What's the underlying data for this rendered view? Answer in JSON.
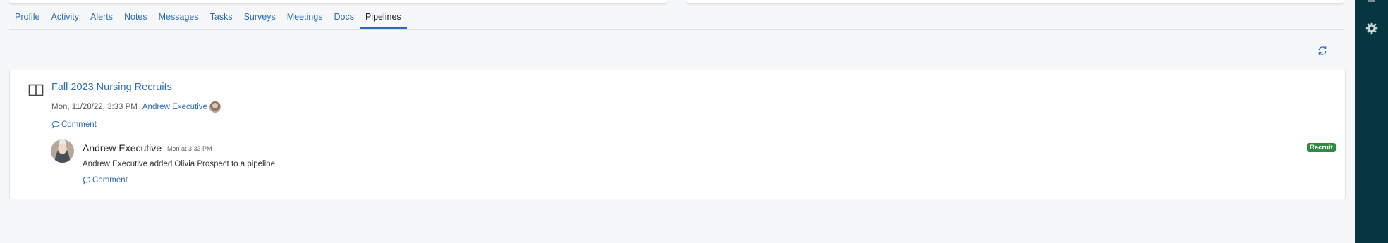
{
  "tabs": [
    {
      "label": "Profile",
      "active": false
    },
    {
      "label": "Activity",
      "active": false
    },
    {
      "label": "Alerts",
      "active": false
    },
    {
      "label": "Notes",
      "active": false
    },
    {
      "label": "Messages",
      "active": false
    },
    {
      "label": "Tasks",
      "active": false
    },
    {
      "label": "Surveys",
      "active": false
    },
    {
      "label": "Meetings",
      "active": false
    },
    {
      "label": "Docs",
      "active": false
    },
    {
      "label": "Pipelines",
      "active": true
    }
  ],
  "pipeline": {
    "icon": "board-columns-icon",
    "title": "Fall 2023 Nursing Recruits",
    "timestamp": "Mon, 11/28/22, 3:33 PM",
    "user": "Andrew Executive",
    "comment_label": "Comment"
  },
  "activity": {
    "author": "Andrew Executive",
    "time": "Mon at 3:33 PM",
    "text": "Andrew Executive added Olivia Prospect to a pipeline",
    "comment_label": "Comment",
    "badge": "Recruit",
    "badge_color": "#2f8a44"
  },
  "colors": {
    "link": "#2b6cb6",
    "sidebar": "#073540",
    "background": "#f5f7f9"
  },
  "icons": {
    "refresh": "refresh-icon",
    "settings": "gear-icon",
    "comment": "speech-bubble-icon"
  }
}
